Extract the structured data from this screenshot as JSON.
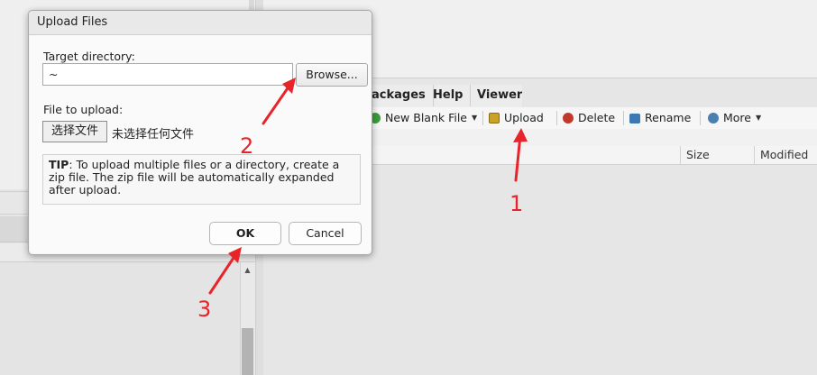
{
  "background": {
    "tabs": [
      "ackages",
      "Help",
      "Viewer"
    ],
    "toolbar": {
      "new_blank_file": "New Blank File",
      "upload": "Upload",
      "delete": "Delete",
      "rename": "Rename",
      "more": "More"
    },
    "columns": {
      "size": "Size",
      "modified": "Modified"
    }
  },
  "dialog": {
    "title": "Upload Files",
    "target_label": "Target directory:",
    "target_value": "~",
    "browse_label": "Browse...",
    "file_label": "File to upload:",
    "choose_label": "选择文件",
    "no_file_text": "未选择任何文件",
    "tip_prefix": "TIP",
    "tip_text": ": To upload multiple files or a directory, create a zip file. The zip file will be automatically expanded after upload.",
    "ok_label": "OK",
    "cancel_label": "Cancel"
  },
  "annotations": {
    "color": "#e8232a",
    "labels": [
      "1",
      "2",
      "3"
    ]
  }
}
